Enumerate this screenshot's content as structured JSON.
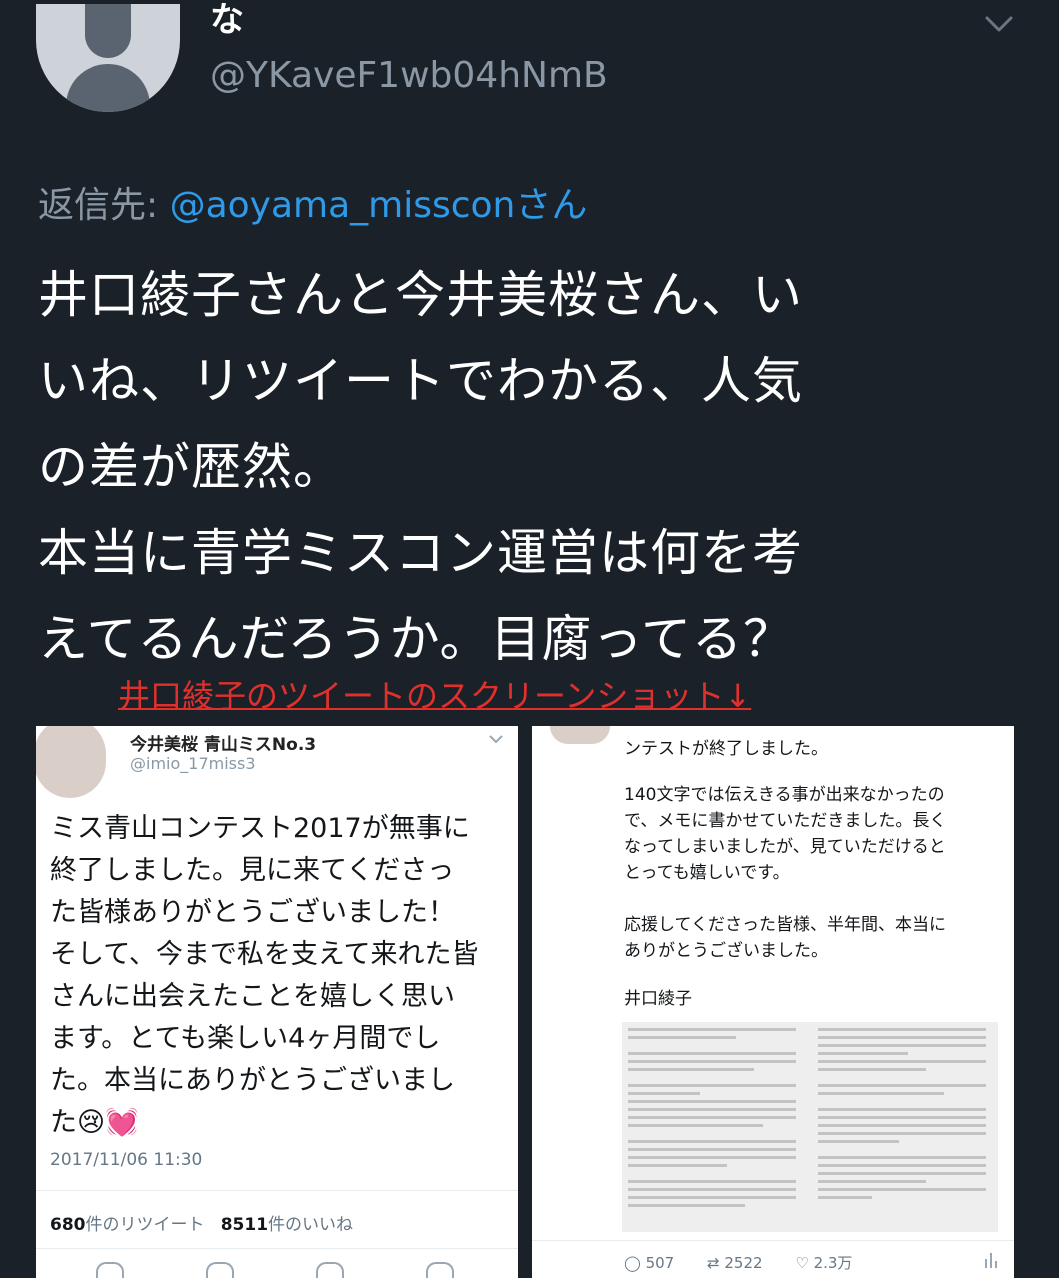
{
  "profile": {
    "name": "な",
    "handle": "@YKaveF1wb04hNmB",
    "avatar_icon": "default-user-avatar-icon",
    "menu_icon": "chevron-down-icon"
  },
  "reply": {
    "prefix": "返信先: ",
    "mention": "@aoyama_missconさん"
  },
  "tweet_text": "井口綾子さんと今井美桜さん、い\nいね、リツイートでわかる、人気\nの差が歴然。\n本当に青学ミスコン運営は何を考\nえてるんだろうか。目腐ってる？",
  "caption": "井口綾子のツイートのスクリーンショット↓",
  "colors": {
    "background": "#1b2129",
    "mention": "#2f9ae8",
    "caption_red": "#e0302c",
    "secondary_text": "#8a97a5"
  },
  "left_card": {
    "name": "今井美桜 青山ミスNo.3",
    "handle": "@imio_17miss3",
    "body": "ミス青山コンテスト2017が無事に\n終了しました。見に来てくださっ\nた皆様ありがとうございました！\nそして、今まで私を支えて来れた皆\nさんに出会えたことを嬉しく思い\nます。とても楽しい4ヶ月間でし\nた。本当にありがとうございまし\nた",
    "emoji": "😢💓",
    "timestamp": "2017/11/06 11:30",
    "retweets": "680",
    "retweets_label": "件のリツイート",
    "likes": "8511",
    "likes_label": "件のいいね"
  },
  "right_card": {
    "top_text": "ンテストが終了しました。",
    "body": "140文字では伝えきる事が出来なかったの\nで、メモに書かせていただきました。長く\nなってしまいましたが、見ていただけると\nとっても嬉しいです。\n\n応援してくださった皆様、半年間、本当に\nありがとうございました。",
    "signature": "井口綾子",
    "replies": "507",
    "retweets": "2522",
    "likes": "2.3万"
  }
}
